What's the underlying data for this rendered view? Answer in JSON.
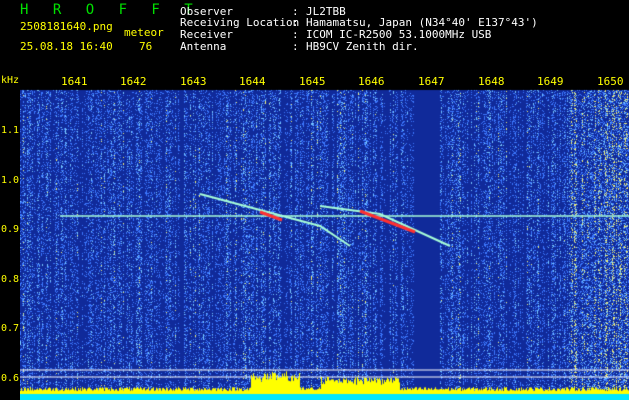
{
  "header": {
    "app_name": "H R O F F T",
    "filename": "2508181640.png",
    "timestamp": "25.08.18 16:40",
    "event_label": "meteor",
    "event_count": "76",
    "info": [
      {
        "key": "Observer",
        "value": "JL2TBB"
      },
      {
        "key": "Receiving Location",
        "value": "Hamamatsu, Japan (N34°40' E137°43')"
      },
      {
        "key": "Receiver",
        "value": "ICOM IC-R2500 53.1000MHz USB"
      },
      {
        "key": "Antenna",
        "value": "HB9CV Zenith dir."
      }
    ]
  },
  "time_axis": [
    "1641",
    "1642",
    "1643",
    "1644",
    "1645",
    "1646",
    "1647",
    "1648",
    "1649",
    "1650"
  ],
  "freq_axis": {
    "unit": "kHz",
    "ticks": [
      "1.1",
      "1.0",
      "0.9",
      "0.8",
      "0.7",
      "0.6"
    ]
  },
  "colors": {
    "background": "#102a9a",
    "noise": "#3a78ff",
    "carrier": "#a8ffd8",
    "meteor": "#ff3030",
    "header_text": "#ffff00",
    "title_text": "#00e000"
  }
}
